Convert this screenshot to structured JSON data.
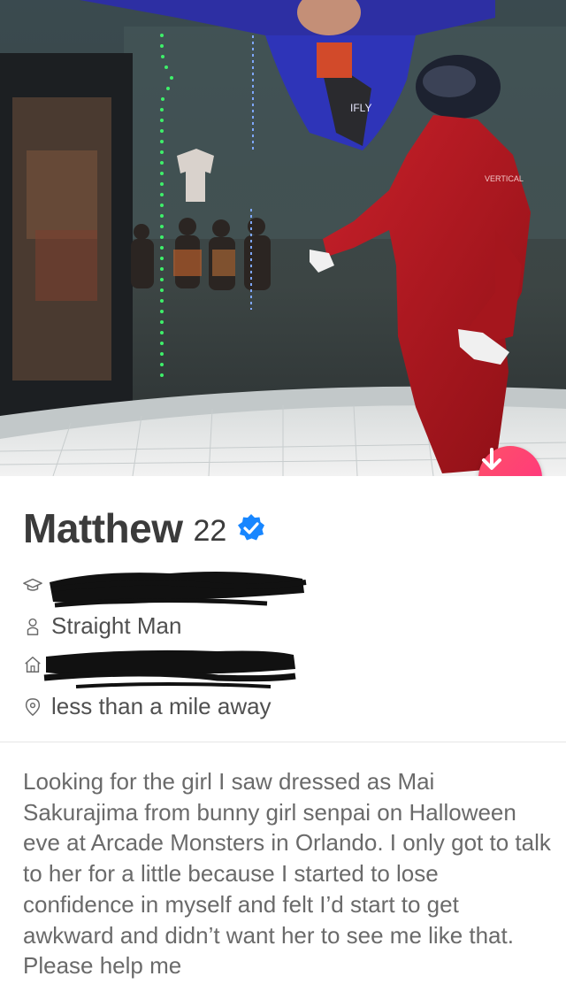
{
  "profile": {
    "name": "Matthew",
    "age": "22",
    "gender": "Straight Man",
    "distance": "less than a mile away",
    "bio": "Looking for the girl I saw dressed as Mai Sakurajima from bunny girl senpai on Halloween eve at Arcade Monsters in Orlando. I only got to talk to her for a little because I started to lose confidence in myself and felt I’d start to get awkward and didn’t want her to see me like that. Please help me"
  },
  "photo": {
    "suit_brand": "IFLY",
    "sign_text": "VERTICAL"
  },
  "icons": {
    "collapse": "arrow-down-icon",
    "verified": "verified-badge-icon",
    "school": "graduation-cap-icon",
    "gender": "person-icon",
    "home": "house-icon",
    "location": "location-pin-icon"
  },
  "colors": {
    "accent": "#fd5068",
    "verified": "#1786ff",
    "text_primary": "#3b3b3b",
    "text_secondary": "#6a6a6a"
  }
}
